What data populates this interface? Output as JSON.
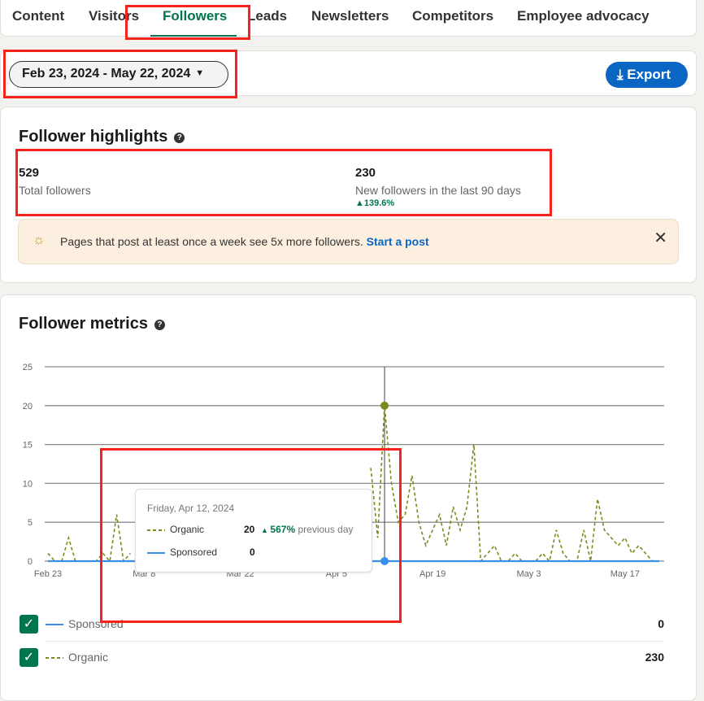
{
  "tabs": [
    {
      "label": "Content"
    },
    {
      "label": "Visitors"
    },
    {
      "label": "Followers",
      "active": true
    },
    {
      "label": "Leads"
    },
    {
      "label": "Newsletters"
    },
    {
      "label": "Competitors"
    },
    {
      "label": "Employee advocacy"
    }
  ],
  "date_range": "Feb 23, 2024 - May 22, 2024",
  "export_label": "Export",
  "highlights": {
    "title": "Follower highlights",
    "total": "529",
    "total_label": "Total followers",
    "new": "230",
    "new_label": "New followers in the last 90 days",
    "change": "139.6%",
    "tip": "Pages that post at least once a week see 5x more followers.",
    "tip_link": "Start a post"
  },
  "metrics": {
    "title": "Follower metrics",
    "tooltip": {
      "date": "Friday, Apr 12, 2024",
      "organic_label": "Organic",
      "organic_value": "20",
      "organic_change": "567%",
      "organic_change_suffix": "previous day",
      "sponsored_label": "Sponsored",
      "sponsored_value": "0"
    },
    "legend": [
      {
        "name": "Sponsored",
        "value": "0",
        "checked": true
      },
      {
        "name": "Organic",
        "value": "230",
        "checked": true
      }
    ]
  },
  "colors": {
    "organic": "#7a8c1f",
    "sponsored": "#378fe9",
    "accent": "#01754f",
    "link": "#0a66c2"
  },
  "chart_data": {
    "type": "line",
    "start_date": "2024-02-23",
    "ylim": [
      0,
      25
    ],
    "yticks": [
      0,
      5,
      10,
      15,
      20,
      25
    ],
    "xticks": [
      "Feb 23",
      "Mar 8",
      "Mar 22",
      "Apr 5",
      "Apr 19",
      "May 3",
      "May 17"
    ],
    "xtick_days": [
      0,
      14,
      28,
      42,
      56,
      70,
      84
    ],
    "grid": true,
    "highlighted_date": "Apr 12",
    "series": [
      {
        "name": "Organic",
        "style": "dashed",
        "values": [
          1,
          0,
          0,
          3,
          0,
          0,
          0,
          0,
          1,
          0,
          6,
          0,
          1,
          null,
          null,
          null,
          null,
          null,
          null,
          null,
          null,
          null,
          null,
          null,
          null,
          null,
          null,
          null,
          null,
          null,
          null,
          null,
          null,
          null,
          null,
          null,
          null,
          null,
          null,
          null,
          null,
          null,
          null,
          null,
          null,
          null,
          null,
          12,
          3,
          20,
          10,
          5,
          6,
          11,
          5,
          2,
          4,
          6,
          2,
          7,
          4,
          7,
          15,
          0,
          1,
          2,
          0,
          0,
          1,
          0,
          0,
          0,
          1,
          0,
          4,
          1,
          0,
          0,
          4,
          0,
          8,
          4,
          3,
          2,
          3,
          1,
          2,
          1,
          0,
          0
        ]
      },
      {
        "name": "Sponsored",
        "style": "solid",
        "values": [
          0,
          0,
          0,
          0,
          0,
          0,
          0,
          0,
          0,
          0,
          0,
          0,
          0,
          0,
          0,
          0,
          0,
          0,
          0,
          0,
          0,
          0,
          0,
          0,
          0,
          0,
          0,
          0,
          0,
          0,
          0,
          0,
          0,
          0,
          0,
          0,
          0,
          0,
          0,
          0,
          0,
          0,
          0,
          0,
          0,
          0,
          0,
          0,
          0,
          0,
          0,
          0,
          0,
          0,
          0,
          0,
          0,
          0,
          0,
          0,
          0,
          0,
          0,
          0,
          0,
          0,
          0,
          0,
          0,
          0,
          0,
          0,
          0,
          0,
          0,
          0,
          0,
          0,
          0,
          0,
          0,
          0,
          0,
          0,
          0,
          0,
          0,
          0,
          0,
          0
        ]
      }
    ]
  }
}
